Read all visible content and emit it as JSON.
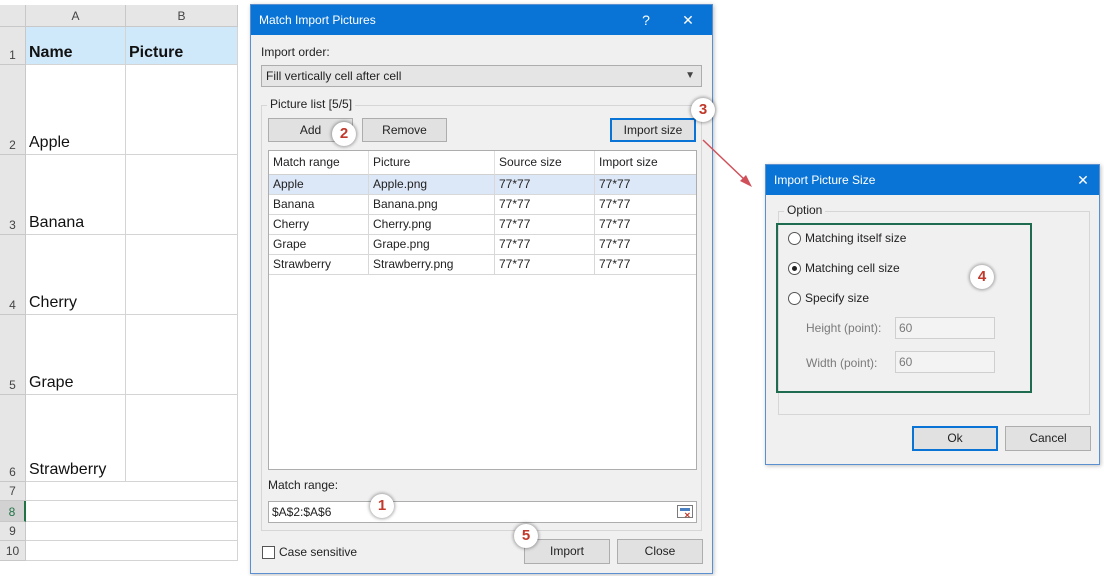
{
  "sheet": {
    "columns": [
      "A",
      "B"
    ],
    "headers": {
      "row": "1",
      "a": "Name",
      "b": "Picture"
    },
    "rows": [
      {
        "num": "2",
        "name": "Apple"
      },
      {
        "num": "3",
        "name": "Banana"
      },
      {
        "num": "4",
        "name": "Cherry"
      },
      {
        "num": "5",
        "name": "Grape"
      },
      {
        "num": "6",
        "name": "Strawberry"
      }
    ],
    "empty_rows": [
      "7",
      "8",
      "9",
      "10"
    ],
    "selected_row": "8",
    "header_fill": "#cfe8fa"
  },
  "match_dialog": {
    "title": "Match Import Pictures",
    "help_label": "?",
    "close_label": "✕",
    "import_order_label": "Import order:",
    "import_order_value": "Fill vertically cell after cell",
    "picture_list_title": "Picture list [5/5]",
    "add_label": "Add",
    "remove_label": "Remove",
    "import_size_label": "Import size",
    "grid_headers": [
      "Match range",
      "Picture",
      "Source size",
      "Import size"
    ],
    "grid_rows": [
      [
        "Apple",
        "Apple.png",
        "77*77",
        "77*77"
      ],
      [
        "Banana",
        "Banana.png",
        "77*77",
        "77*77"
      ],
      [
        "Cherry",
        "Cherry.png",
        "77*77",
        "77*77"
      ],
      [
        "Grape",
        "Grape.png",
        "77*77",
        "77*77"
      ],
      [
        "Strawberry",
        "Strawberry.png",
        "77*77",
        "77*77"
      ]
    ],
    "match_range_label": "Match range:",
    "match_range_value": "$A$2:$A$6",
    "case_sensitive_label": "Case sensitive",
    "case_sensitive_checked": false,
    "import_label": "Import",
    "close_button_label": "Close",
    "title_color": "#0a74d6"
  },
  "size_dialog": {
    "title": "Import Picture Size",
    "close_label": "✕",
    "option_title": "Option",
    "options": [
      "Matching itself size",
      "Matching cell size",
      "Specify size"
    ],
    "selected_option": "Matching cell size",
    "height_label": "Height (point):",
    "height_value": "60",
    "width_label": "Width (point):",
    "width_value": "60",
    "ok_label": "Ok",
    "cancel_label": "Cancel"
  },
  "markers": [
    "1",
    "2",
    "3",
    "4",
    "5"
  ],
  "accent": {
    "marker_text": "#c0392b",
    "highlight_border": "#1e6b50",
    "arrow": "#d0505a"
  }
}
